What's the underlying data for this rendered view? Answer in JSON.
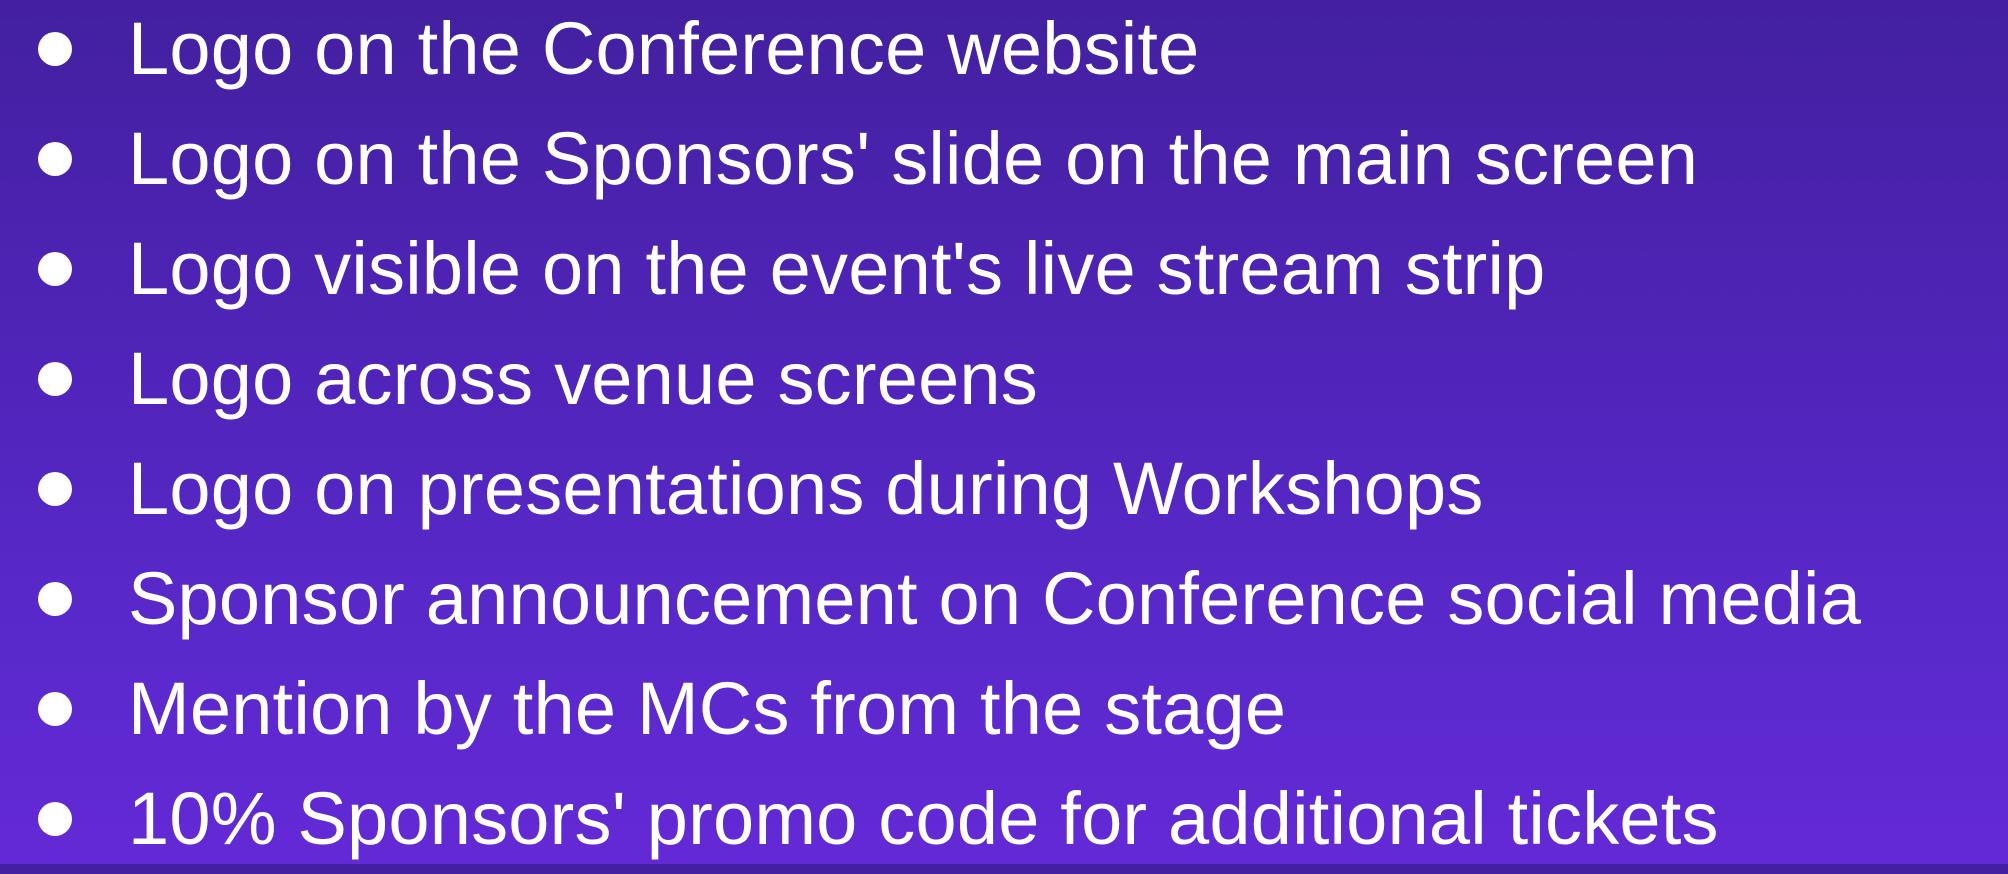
{
  "benefits": [
    {
      "text": "Logo on the Conference website"
    },
    {
      "text": "Logo on the Sponsors' slide on the main screen"
    },
    {
      "text": "Logo visible on the event's live stream strip"
    },
    {
      "text": "Logo across venue screens"
    },
    {
      "text": "Logo on presentations during Workshops"
    },
    {
      "text": "Sponsor announcement on Conference social media"
    },
    {
      "text": "Mention by the MCs from the stage"
    },
    {
      "text": "10% Sponsors' promo code for additional tickets"
    }
  ],
  "colors": {
    "background_top": "#4320a0",
    "background_bottom": "#6329d6",
    "text": "#ffffff",
    "bullet": "#ffffff"
  }
}
